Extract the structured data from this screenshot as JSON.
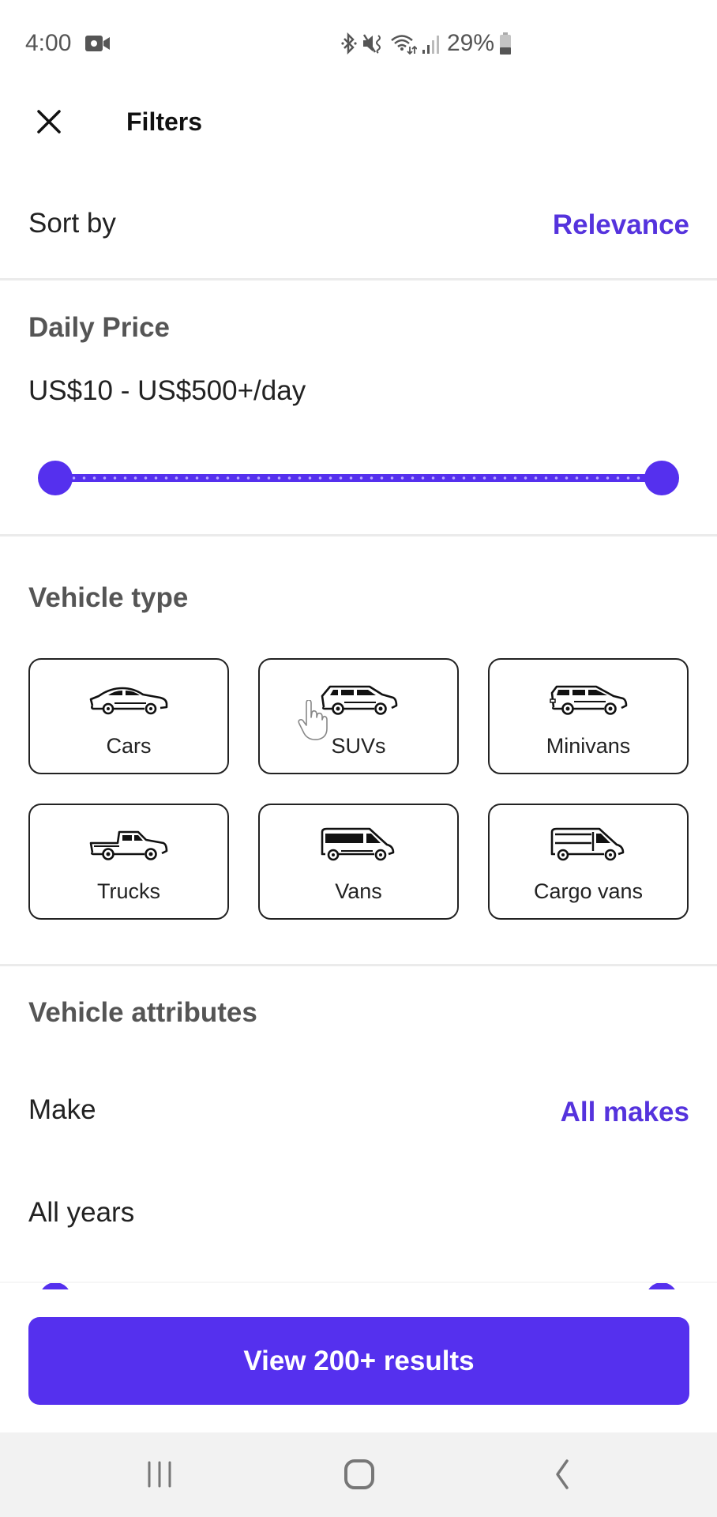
{
  "status_bar": {
    "time": "4:00",
    "battery_percent": "29%",
    "icons": [
      "video-camera-icon",
      "bluetooth-icon",
      "mute-vibrate-icon",
      "wifi-icon",
      "signal-icon",
      "battery-icon"
    ]
  },
  "header": {
    "title": "Filters",
    "close_icon": "close-icon"
  },
  "sort": {
    "label": "Sort by",
    "value": "Relevance"
  },
  "daily_price": {
    "title": "Daily Price",
    "range_text": "US$10 - US$500+/day",
    "slider": {
      "min_label": "US$10",
      "max_label": "US$500+",
      "low_fraction": 0,
      "high_fraction": 1
    }
  },
  "vehicle_type": {
    "title": "Vehicle type",
    "options": [
      {
        "label": "Cars",
        "icon": "sedan-icon",
        "selected": false
      },
      {
        "label": "SUVs",
        "icon": "suv-icon",
        "selected": false
      },
      {
        "label": "Minivans",
        "icon": "minivan-icon",
        "selected": false
      },
      {
        "label": "Trucks",
        "icon": "pickup-truck-icon",
        "selected": false
      },
      {
        "label": "Vans",
        "icon": "van-icon",
        "selected": false
      },
      {
        "label": "Cargo vans",
        "icon": "cargo-van-icon",
        "selected": false
      }
    ]
  },
  "vehicle_attributes": {
    "title": "Vehicle attributes",
    "make": {
      "label": "Make",
      "value": "All makes"
    },
    "years": {
      "label": "All years",
      "low_fraction": 0,
      "high_fraction": 1
    }
  },
  "footer": {
    "cta_label": "View 200+ results"
  },
  "colors": {
    "accent": "#5530ee",
    "link": "#5533dd",
    "heading_gray": "#555555",
    "divider": "#ebebeb",
    "navbar_bg": "#f2f2f2"
  },
  "navbar": {
    "buttons": [
      "recent-apps-icon",
      "home-icon",
      "back-icon"
    ]
  }
}
